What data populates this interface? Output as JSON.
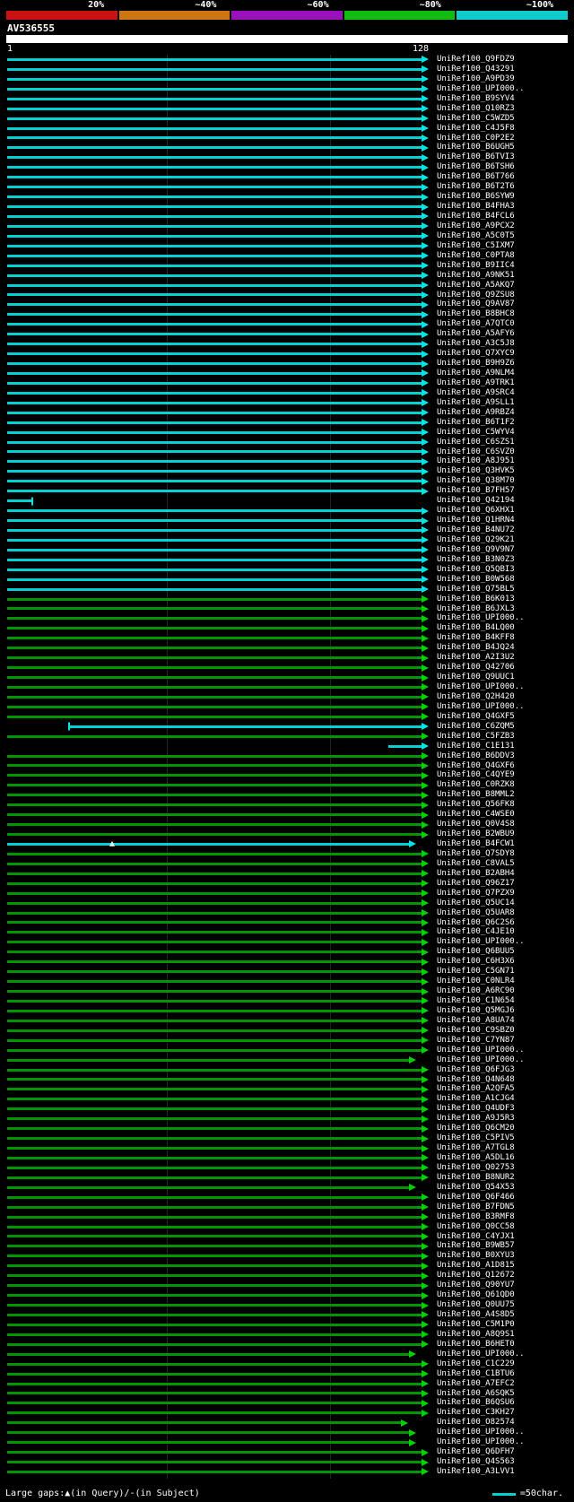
{
  "identity_scale": {
    "labels": [
      "20%",
      "~40%",
      "~60%",
      "~80%",
      "~100%"
    ],
    "colors": [
      "#cc1111",
      "#cc7711",
      "#9911bb",
      "#11bb11",
      "#11cccc"
    ]
  },
  "query": {
    "name": "AV536555",
    "ruler_start": "1",
    "ruler_end": "128"
  },
  "footer": {
    "gaps_legend": "Large gaps:▲(in Query)/-(in Subject)",
    "scale_line_label": "=50char."
  },
  "render_colors": {
    "cyan_bar": "#00d2d2",
    "cyan_arrow": "#00e6e6",
    "green_bar": "#009600",
    "green_arrow": "#00d200"
  },
  "chart_data": {
    "type": "bar",
    "orientation": "horizontal",
    "title": "AV536555",
    "x_range": [
      1,
      128
    ],
    "x_start_label": "1",
    "x_end_label": "128",
    "gridlines_every_chars": 50,
    "identity_legend": {
      "cyan": "~100%",
      "green": "~80%"
    },
    "rows": [
      {
        "label": "UniRef100_Q9FDZ9",
        "identity": "cyan"
      },
      {
        "label": "UniRef100_Q43291",
        "identity": "cyan"
      },
      {
        "label": "UniRef100_A9PD39",
        "identity": "cyan"
      },
      {
        "label": "UniRef100_UPI000..",
        "identity": "cyan"
      },
      {
        "label": "UniRef100_B9SYV4",
        "identity": "cyan"
      },
      {
        "label": "UniRef100_Q10RZ3",
        "identity": "cyan"
      },
      {
        "label": "UniRef100_C5WZD5",
        "identity": "cyan"
      },
      {
        "label": "UniRef100_C4J5F8",
        "identity": "cyan"
      },
      {
        "label": "UniRef100_C0P2E2",
        "identity": "cyan"
      },
      {
        "label": "UniRef100_B6UGH5",
        "identity": "cyan"
      },
      {
        "label": "UniRef100_B6TVI3",
        "identity": "cyan"
      },
      {
        "label": "UniRef100_B6TSH6",
        "identity": "cyan"
      },
      {
        "label": "UniRef100_B6T766",
        "identity": "cyan"
      },
      {
        "label": "UniRef100_B6T2T6",
        "identity": "cyan"
      },
      {
        "label": "UniRef100_B6SYW9",
        "identity": "cyan"
      },
      {
        "label": "UniRef100_B4FHA3",
        "identity": "cyan"
      },
      {
        "label": "UniRef100_B4FCL6",
        "identity": "cyan"
      },
      {
        "label": "UniRef100_A9PCX2",
        "identity": "cyan"
      },
      {
        "label": "UniRef100_A5C0T5",
        "identity": "cyan"
      },
      {
        "label": "UniRef100_C5IXM7",
        "identity": "cyan"
      },
      {
        "label": "UniRef100_C0PTA8",
        "identity": "cyan"
      },
      {
        "label": "UniRef100_B9IIC4",
        "identity": "cyan"
      },
      {
        "label": "UniRef100_A9NK51",
        "identity": "cyan"
      },
      {
        "label": "UniRef100_A5AKQ7",
        "identity": "cyan"
      },
      {
        "label": "UniRef100_Q9ZSU8",
        "identity": "cyan"
      },
      {
        "label": "UniRef100_Q9AV87",
        "identity": "cyan"
      },
      {
        "label": "UniRef100_B8BHC8",
        "identity": "cyan"
      },
      {
        "label": "UniRef100_A7QTC0",
        "identity": "cyan"
      },
      {
        "label": "UniRef100_A5AFY6",
        "identity": "cyan"
      },
      {
        "label": "UniRef100_A3C5J8",
        "identity": "cyan"
      },
      {
        "label": "UniRef100_Q7XYC9",
        "identity": "cyan"
      },
      {
        "label": "UniRef100_B9H9Z6",
        "identity": "cyan"
      },
      {
        "label": "UniRef100_A9NLM4",
        "identity": "cyan"
      },
      {
        "label": "UniRef100_A9TRK1",
        "identity": "cyan"
      },
      {
        "label": "UniRef100_A9SRC4",
        "identity": "cyan"
      },
      {
        "label": "UniRef100_A9SLL1",
        "identity": "cyan"
      },
      {
        "label": "UniRef100_A9RBZ4",
        "identity": "cyan"
      },
      {
        "label": "UniRef100_B6T1F2",
        "identity": "cyan"
      },
      {
        "label": "UniRef100_C5WYV4",
        "identity": "cyan"
      },
      {
        "label": "UniRef100_C6SZS1",
        "identity": "cyan"
      },
      {
        "label": "UniRef100_C6SVZ0",
        "identity": "cyan"
      },
      {
        "label": "UniRef100_A8J951",
        "identity": "cyan"
      },
      {
        "label": "UniRef100_Q3HVK5",
        "identity": "cyan"
      },
      {
        "label": "UniRef100_Q38M70",
        "identity": "cyan"
      },
      {
        "label": "UniRef100_B7FH57",
        "identity": "cyan"
      },
      {
        "label": "UniRef100_Q42194",
        "identity": "cyan",
        "start_pct": 0,
        "end_pct": 6,
        "arrow": false,
        "tick": "end"
      },
      {
        "label": "UniRef100_Q6XHX1",
        "identity": "cyan"
      },
      {
        "label": "UniRef100_Q1HRN4",
        "identity": "cyan"
      },
      {
        "label": "UniRef100_B4NU72",
        "identity": "cyan"
      },
      {
        "label": "UniRef100_Q29K21",
        "identity": "cyan"
      },
      {
        "label": "UniRef100_Q9V9N7",
        "identity": "cyan"
      },
      {
        "label": "UniRef100_B3N0Z3",
        "identity": "cyan"
      },
      {
        "label": "UniRef100_Q5QBI3",
        "identity": "cyan"
      },
      {
        "label": "UniRef100_B0W568",
        "identity": "cyan"
      },
      {
        "label": "UniRef100_Q75BL5",
        "identity": "cyan"
      },
      {
        "label": "UniRef100_B6K013",
        "identity": "green"
      },
      {
        "label": "UniRef100_B6JXL3",
        "identity": "green"
      },
      {
        "label": "UniRef100_UPI000..",
        "identity": "green"
      },
      {
        "label": "UniRef100_B4LQ00",
        "identity": "green"
      },
      {
        "label": "UniRef100_B4KFF8",
        "identity": "green"
      },
      {
        "label": "UniRef100_B4JQ24",
        "identity": "green"
      },
      {
        "label": "UniRef100_A2I3U2",
        "identity": "green"
      },
      {
        "label": "UniRef100_Q42706",
        "identity": "green"
      },
      {
        "label": "UniRef100_Q9UUC1",
        "identity": "green"
      },
      {
        "label": "UniRef100_UPI000..",
        "identity": "green"
      },
      {
        "label": "UniRef100_Q2H420",
        "identity": "green"
      },
      {
        "label": "UniRef100_UPI000..",
        "identity": "green"
      },
      {
        "label": "UniRef100_Q4GXF5",
        "identity": "green"
      },
      {
        "label": "UniRef100_C6ZQM5",
        "identity": "cyan",
        "start_pct": 15,
        "end_pct": 100,
        "tick": "start"
      },
      {
        "label": "UniRef100_C5FZB3",
        "identity": "green"
      },
      {
        "label": "UniRef100_C1E131",
        "identity": "cyan",
        "start_pct": 92,
        "end_pct": 100
      },
      {
        "label": "UniRef100_B6DDV3",
        "identity": "green"
      },
      {
        "label": "UniRef100_Q4GXF6",
        "identity": "green"
      },
      {
        "label": "UniRef100_C4QYE9",
        "identity": "green"
      },
      {
        "label": "UniRef100_C0RZK8",
        "identity": "green"
      },
      {
        "label": "UniRef100_B8MML2",
        "identity": "green"
      },
      {
        "label": "UniRef100_Q56FK8",
        "identity": "green"
      },
      {
        "label": "UniRef100_C4WSE0",
        "identity": "green"
      },
      {
        "label": "UniRef100_Q0V4S8",
        "identity": "green"
      },
      {
        "label": "UniRef100_B2WBU9",
        "identity": "green"
      },
      {
        "label": "UniRef100_B4FCW1",
        "identity": "cyan",
        "start_pct": 0,
        "end_pct": 97,
        "gap_pct": 26
      },
      {
        "label": "UniRef100_Q7SDY8",
        "identity": "green"
      },
      {
        "label": "UniRef100_C8VAL5",
        "identity": "green"
      },
      {
        "label": "UniRef100_B2ABH4",
        "identity": "green"
      },
      {
        "label": "UniRef100_Q96Z17",
        "identity": "green"
      },
      {
        "label": "UniRef100_Q7PZX9",
        "identity": "green"
      },
      {
        "label": "UniRef100_Q5UC14",
        "identity": "green"
      },
      {
        "label": "UniRef100_Q5UAR8",
        "identity": "green"
      },
      {
        "label": "UniRef100_Q6C2S6",
        "identity": "green"
      },
      {
        "label": "UniRef100_C4JE10",
        "identity": "green"
      },
      {
        "label": "UniRef100_UPI000..",
        "identity": "green"
      },
      {
        "label": "UniRef100_Q6BUU5",
        "identity": "green"
      },
      {
        "label": "UniRef100_C6H3X6",
        "identity": "green"
      },
      {
        "label": "UniRef100_C5GN71",
        "identity": "green"
      },
      {
        "label": "UniRef100_C0NLR4",
        "identity": "green"
      },
      {
        "label": "UniRef100_A6RC90",
        "identity": "green"
      },
      {
        "label": "UniRef100_C1N654",
        "identity": "green"
      },
      {
        "label": "UniRef100_Q5MGJ6",
        "identity": "green"
      },
      {
        "label": "UniRef100_A8UA74",
        "identity": "green"
      },
      {
        "label": "UniRef100_C9SBZ0",
        "identity": "green"
      },
      {
        "label": "UniRef100_C7YN87",
        "identity": "green"
      },
      {
        "label": "UniRef100_UPI000..",
        "identity": "green"
      },
      {
        "label": "UniRef100_UPI000..",
        "identity": "green",
        "end_pct": 97
      },
      {
        "label": "UniRef100_Q6FJG3",
        "identity": "green"
      },
      {
        "label": "UniRef100_Q4N648",
        "identity": "green"
      },
      {
        "label": "UniRef100_A2QFA5",
        "identity": "green"
      },
      {
        "label": "UniRef100_A1CJG4",
        "identity": "green"
      },
      {
        "label": "UniRef100_Q4UDF3",
        "identity": "green"
      },
      {
        "label": "UniRef100_A9J5R3",
        "identity": "green"
      },
      {
        "label": "UniRef100_Q6CM20",
        "identity": "green"
      },
      {
        "label": "UniRef100_C5PIV5",
        "identity": "green"
      },
      {
        "label": "UniRef100_A7TGL8",
        "identity": "green"
      },
      {
        "label": "UniRef100_A5DL16",
        "identity": "green"
      },
      {
        "label": "UniRef100_Q02753",
        "identity": "green"
      },
      {
        "label": "UniRef100_B8NUR2",
        "identity": "green"
      },
      {
        "label": "UniRef100_Q54X53",
        "identity": "green",
        "end_pct": 97
      },
      {
        "label": "UniRef100_Q6F466",
        "identity": "green"
      },
      {
        "label": "UniRef100_B7FDN5",
        "identity": "green"
      },
      {
        "label": "UniRef100_B3RMF8",
        "identity": "green"
      },
      {
        "label": "UniRef100_Q0CC58",
        "identity": "green"
      },
      {
        "label": "UniRef100_C4YJX1",
        "identity": "green"
      },
      {
        "label": "UniRef100_B9WB57",
        "identity": "green"
      },
      {
        "label": "UniRef100_B0XYU3",
        "identity": "green"
      },
      {
        "label": "UniRef100_A1D815",
        "identity": "green"
      },
      {
        "label": "UniRef100_Q12672",
        "identity": "green"
      },
      {
        "label": "UniRef100_Q90YU7",
        "identity": "green"
      },
      {
        "label": "UniRef100_Q61QD0",
        "identity": "green"
      },
      {
        "label": "UniRef100_Q0UU75",
        "identity": "green"
      },
      {
        "label": "UniRef100_A4S8D5",
        "identity": "green"
      },
      {
        "label": "UniRef100_C5M1P0",
        "identity": "green"
      },
      {
        "label": "UniRef100_A8Q9S1",
        "identity": "green"
      },
      {
        "label": "UniRef100_B6HET0",
        "identity": "green"
      },
      {
        "label": "UniRef100_UPI000..",
        "identity": "green",
        "end_pct": 97
      },
      {
        "label": "UniRef100_C1C229",
        "identity": "green"
      },
      {
        "label": "UniRef100_C1BTU6",
        "identity": "green"
      },
      {
        "label": "UniRef100_A7EFC2",
        "identity": "green"
      },
      {
        "label": "UniRef100_A6SQK5",
        "identity": "green"
      },
      {
        "label": "UniRef100_B6QSU6",
        "identity": "green"
      },
      {
        "label": "UniRef100_C3KH27",
        "identity": "green"
      },
      {
        "label": "UniRef100_O82574",
        "identity": "green",
        "end_pct": 95
      },
      {
        "label": "UniRef100_UPI000..",
        "identity": "green",
        "end_pct": 97
      },
      {
        "label": "UniRef100_UPI000..",
        "identity": "green",
        "end_pct": 97
      },
      {
        "label": "UniRef100_Q6DFH7",
        "identity": "green"
      },
      {
        "label": "UniRef100_Q4S563",
        "identity": "green"
      },
      {
        "label": "UniRef100_A3LVV1",
        "identity": "green"
      }
    ]
  }
}
